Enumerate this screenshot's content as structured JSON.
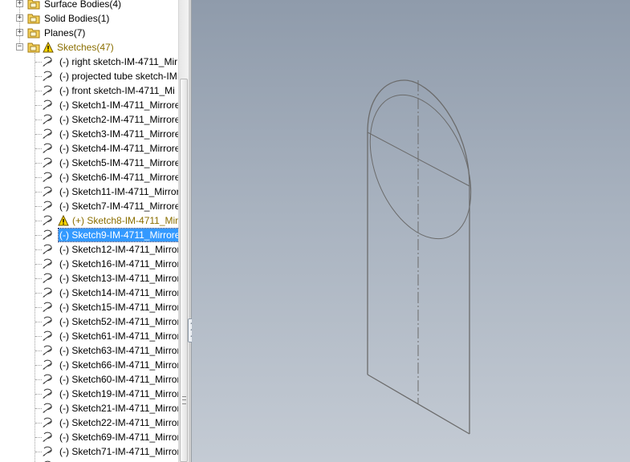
{
  "feature_tree": {
    "top_items": [
      {
        "label": "Surface Bodies(4)",
        "icon": "surface-bodies-folder-icon",
        "expander": "+"
      },
      {
        "label": "Solid Bodies(1)",
        "icon": "solid-bodies-folder-icon",
        "expander": "+"
      },
      {
        "label": "Planes(7)",
        "icon": "planes-folder-icon",
        "expander": "+"
      },
      {
        "label": "Sketches(47)",
        "icon": "sketches-folder-icon",
        "expander": "-",
        "warning": true
      }
    ],
    "sketches": [
      {
        "label": "(-) right sketch-IM-4711_Mir"
      },
      {
        "label": "(-) projected tube sketch-IM"
      },
      {
        "label": "(-) front sketch-IM-4711_Mi"
      },
      {
        "label": "(-) Sketch1-IM-4711_Mirrore"
      },
      {
        "label": "(-) Sketch2-IM-4711_Mirrore"
      },
      {
        "label": "(-) Sketch3-IM-4711_Mirrore"
      },
      {
        "label": "(-) Sketch4-IM-4711_Mirrore"
      },
      {
        "label": "(-) Sketch5-IM-4711_Mirrore"
      },
      {
        "label": "(-) Sketch6-IM-4711_Mirrore"
      },
      {
        "label": "(-) Sketch11-IM-4711_Mirror"
      },
      {
        "label": "(-) Sketch7-IM-4711_Mirrore"
      },
      {
        "label": "(+) Sketch8-IM-4711_Mir",
        "warning": true
      },
      {
        "label": "(-) Sketch9-IM-4711_Mirrore",
        "selected": true
      },
      {
        "label": "(-) Sketch12-IM-4711_Mirror"
      },
      {
        "label": "(-) Sketch16-IM-4711_Mirror"
      },
      {
        "label": "(-) Sketch13-IM-4711_Mirror"
      },
      {
        "label": "(-) Sketch14-IM-4711_Mirror"
      },
      {
        "label": "(-) Sketch15-IM-4711_Mirror"
      },
      {
        "label": "(-) Sketch52-IM-4711_Mirror"
      },
      {
        "label": "(-) Sketch61-IM-4711_Mirror"
      },
      {
        "label": "(-) Sketch63-IM-4711_Mirror"
      },
      {
        "label": "(-) Sketch66-IM-4711_Mirror"
      },
      {
        "label": "(-) Sketch60-IM-4711_Mirror"
      },
      {
        "label": "(-) Sketch19-IM-4711_Mirror"
      },
      {
        "label": "(-) Sketch21-IM-4711_Mirror"
      },
      {
        "label": "(-) Sketch22-IM-4711_Mirror"
      },
      {
        "label": "(-) Sketch69-IM-4711_Mirror"
      },
      {
        "label": "(-) Sketch71-IM-4711_Mirror"
      },
      {
        "label": ""
      }
    ]
  },
  "viewport": {
    "background_top": "#8f9bab",
    "background_bottom": "#c4cbd4",
    "line_color": "#6b6b6b"
  },
  "colors": {
    "selection": "#3399ff",
    "warning_text": "#8a6e00",
    "warning_icon": "#ffd700"
  }
}
